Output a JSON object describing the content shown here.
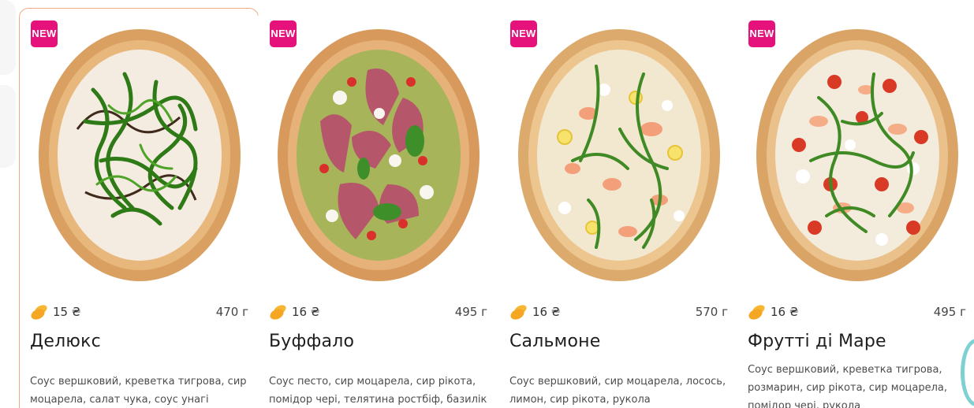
{
  "badge_label": "NEW",
  "currency_icon": "coin-icon",
  "colors": {
    "badge": "#e4127a",
    "selected_border": "#f2a98a",
    "coin": "#f5a623"
  },
  "products": [
    {
      "name": "Делюкс",
      "price": "15 ₴",
      "weight": "470 г",
      "description": "Соус вершковий, креветка тигрова, сир моцарела, салат чука, соус унагі"
    },
    {
      "name": "Буффало",
      "price": "16 ₴",
      "weight": "495 г",
      "description": "Соус песто, сир моцарела, сир рікота, помідор чері, телятина ростбіф, базилік"
    },
    {
      "name": "Сальмоне",
      "price": "16 ₴",
      "weight": "570 г",
      "description": "Соус вершковий, сир моцарела, лосось, лимон, сир рікота, рукола"
    },
    {
      "name": "Фрутті ді Маре",
      "price": "16 ₴",
      "weight": "495 г",
      "description": "Соус вершковий, креветка тигрова, розмарин, сир рікота, сир моцарела, помідор чері, рукола"
    }
  ]
}
